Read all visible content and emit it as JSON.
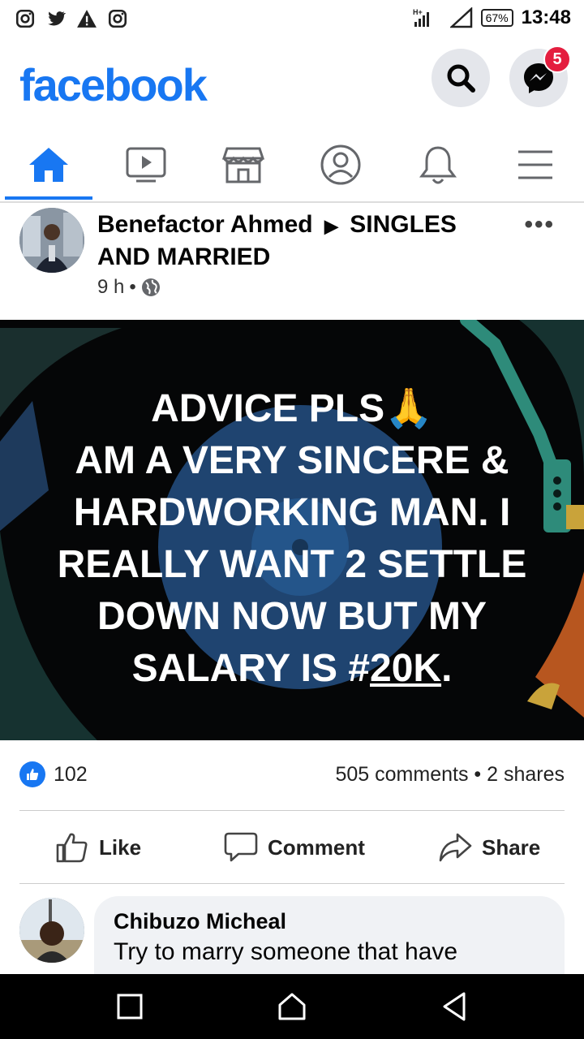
{
  "status_bar": {
    "time": "13:48",
    "battery": "67%"
  },
  "header": {
    "logo": "facebook",
    "messenger_badge": "5",
    "search_icon": "search-icon",
    "messenger_icon": "messenger-icon"
  },
  "tabs": [
    {
      "name": "home",
      "icon": "home-icon",
      "active": true
    },
    {
      "name": "watch",
      "icon": "video-icon"
    },
    {
      "name": "marketplace",
      "icon": "store-icon"
    },
    {
      "name": "profile",
      "icon": "profile-icon"
    },
    {
      "name": "notifications",
      "icon": "bell-icon"
    },
    {
      "name": "menu",
      "icon": "hamburger-icon"
    }
  ],
  "post": {
    "author": "Benefactor Ahmed",
    "group": "SINGLES AND MARRIED",
    "arrow": "▶",
    "time": "9 h",
    "separator": "•",
    "more": "•••",
    "image_text": {
      "line1": "ADVICE PLS",
      "emoji": "🙏",
      "line2": "AM A VERY SINCERE &",
      "line3": "HARDWORKING MAN. I",
      "line4": "REALLY WANT 2 SETTLE",
      "line5": "DOWN NOW BUT MY",
      "line6_prefix": "SALARY IS #",
      "line6_link": "20K",
      "line6_suffix": "."
    },
    "likes": "102",
    "comments_shares": "505 comments • 2 shares"
  },
  "actions": {
    "like": "Like",
    "comment": "Comment",
    "share": "Share"
  },
  "comment": {
    "author": "Chibuzo Micheal",
    "text": "Try to marry someone that have"
  },
  "colors": {
    "brand": "#1877f2",
    "badge": "#e41e3f"
  }
}
